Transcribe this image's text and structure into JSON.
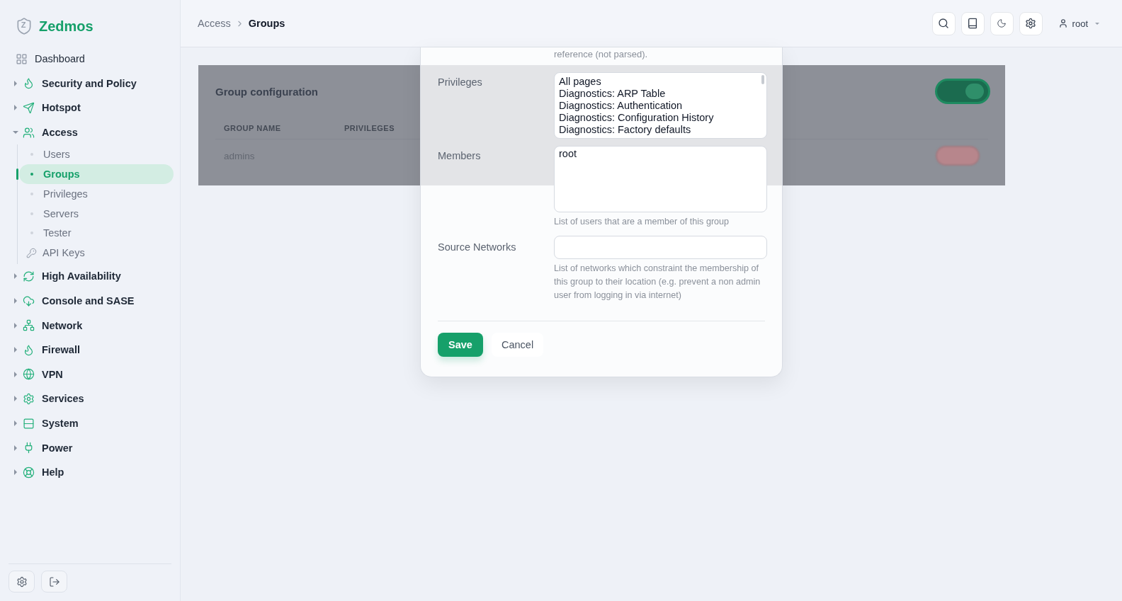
{
  "brand": {
    "logo_letter": "Z",
    "name": "Zedmos"
  },
  "sidebar": {
    "items": [
      {
        "label": "Dashboard",
        "kind": "link"
      },
      {
        "label": "Security and Policy",
        "kind": "group",
        "expanded": false
      },
      {
        "label": "Hotspot",
        "kind": "group",
        "expanded": false
      },
      {
        "label": "Access",
        "kind": "group",
        "expanded": true,
        "children": [
          {
            "label": "Users",
            "kind": "bullet",
            "selected": false
          },
          {
            "label": "Groups",
            "kind": "bullet",
            "selected": true
          },
          {
            "label": "Privileges",
            "kind": "bullet",
            "selected": false
          },
          {
            "label": "Servers",
            "kind": "bullet",
            "selected": false
          },
          {
            "label": "Tester",
            "kind": "bullet",
            "selected": false
          },
          {
            "label": "API Keys",
            "kind": "key",
            "selected": false
          }
        ]
      },
      {
        "label": "High Availability",
        "kind": "group",
        "expanded": false
      },
      {
        "label": "Console and SASE",
        "kind": "group",
        "expanded": false
      },
      {
        "label": "Network",
        "kind": "group",
        "expanded": false
      },
      {
        "label": "Firewall",
        "kind": "group",
        "expanded": false
      },
      {
        "label": "VPN",
        "kind": "group",
        "expanded": false
      },
      {
        "label": "Services",
        "kind": "group",
        "expanded": false
      },
      {
        "label": "System",
        "kind": "group",
        "expanded": false
      },
      {
        "label": "Power",
        "kind": "group",
        "expanded": false
      },
      {
        "label": "Help",
        "kind": "group",
        "expanded": false
      }
    ]
  },
  "breadcrumb": [
    "Access",
    "Groups"
  ],
  "header": {
    "user": "root"
  },
  "card": {
    "title": "Group configuration",
    "enabled": true,
    "columns": [
      "GROUP NAME",
      "PRIVILEGES"
    ],
    "rows": [
      {
        "name": "admins"
      }
    ]
  },
  "modal": {
    "top_note": "reference (not parsed).",
    "fields": [
      {
        "kind": "listbox",
        "label": "Privileges",
        "options": [
          "All pages",
          "Diagnostics: ARP Table",
          "Diagnostics: Authentication",
          "Diagnostics: Configuration History",
          "Diagnostics: Factory defaults"
        ]
      },
      {
        "kind": "textarea",
        "label": "Members",
        "value": "root",
        "help": "List of users that are a member of this group"
      },
      {
        "kind": "input",
        "label": "Source Networks",
        "help": "List of networks which constraint the membership of this group to their location (e.g. prevent a non admin user from logging in via internet)"
      }
    ],
    "save": "Save",
    "cancel": "Cancel"
  }
}
